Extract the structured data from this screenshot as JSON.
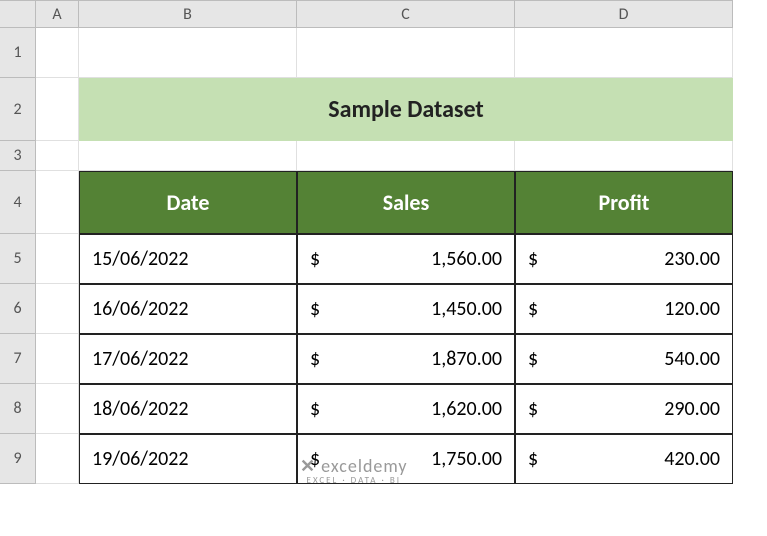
{
  "columns": [
    "A",
    "B",
    "C",
    "D"
  ],
  "rows": [
    "1",
    "2",
    "3",
    "4",
    "5",
    "6",
    "7",
    "8",
    "9"
  ],
  "title": "Sample Dataset",
  "headers": {
    "date": "Date",
    "sales": "Sales",
    "profit": "Profit"
  },
  "currency_symbol": "$",
  "data": [
    {
      "date": "15/06/2022",
      "sales": "1,560.00",
      "profit": "230.00"
    },
    {
      "date": "16/06/2022",
      "sales": "1,450.00",
      "profit": "120.00"
    },
    {
      "date": "17/06/2022",
      "sales": "1,870.00",
      "profit": "540.00"
    },
    {
      "date": "18/06/2022",
      "sales": "1,620.00",
      "profit": "290.00"
    },
    {
      "date": "19/06/2022",
      "sales": "1,750.00",
      "profit": "420.00"
    }
  ],
  "watermark": {
    "main": "exceldemy",
    "sub": "EXCEL · DATA · BI"
  }
}
